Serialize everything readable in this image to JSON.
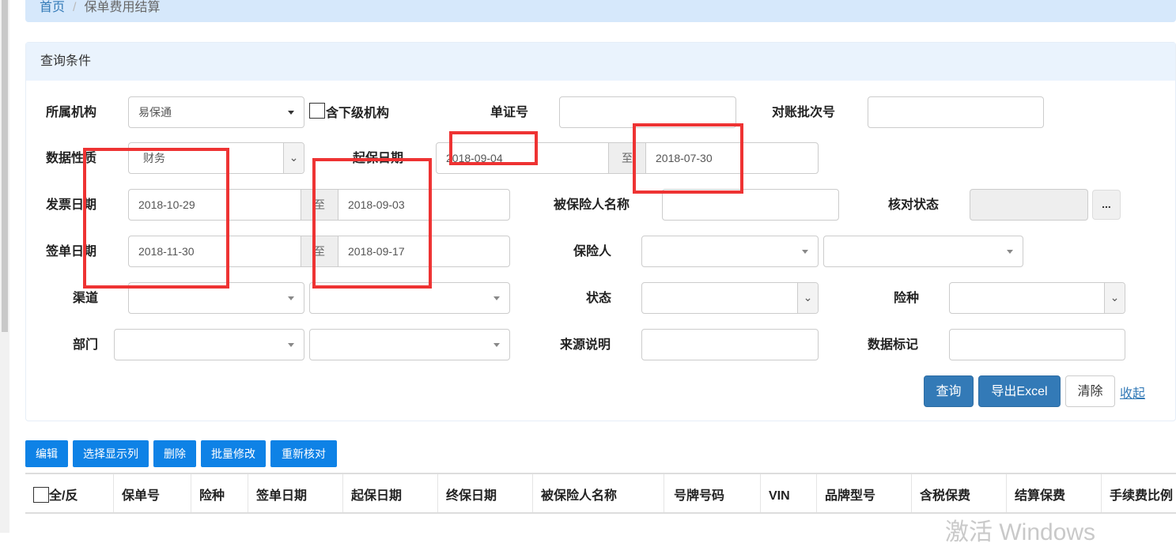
{
  "breadcrumb": {
    "home": "首页",
    "separator": "/",
    "current": "保单费用结算"
  },
  "panel": {
    "title": "查询条件"
  },
  "form": {
    "org_label": "所属机构",
    "org_value": "易保通",
    "include_sub_label": "含下级机构",
    "cert_no_label": "单证号",
    "cert_no_value": "",
    "batch_no_label": "对账批次号",
    "batch_no_value": "",
    "data_nature_label": "数据性质",
    "data_nature_value": "财务",
    "start_date_label": "起保日期",
    "start_date_from": "2018-09-04",
    "start_date_to": "2018-07-30",
    "invoice_date_label": "发票日期",
    "invoice_date_from": "2018-10-29",
    "invoice_date_to": "2018-09-03",
    "insured_name_label": "被保险人名称",
    "insured_name_value": "",
    "check_status_label": "核对状态",
    "check_status_value": "",
    "check_status_more": "...",
    "sign_date_label": "签单日期",
    "sign_date_from": "2018-11-30",
    "sign_date_to": "2018-09-17",
    "insurer_label": "保险人",
    "channel_label": "渠道",
    "status_label": "状态",
    "risk_type_label": "险种",
    "dept_label": "部门",
    "source_desc_label": "来源说明",
    "source_desc_value": "",
    "data_mark_label": "数据标记",
    "data_mark_value": "",
    "range_to": "至"
  },
  "actions": {
    "query": "查询",
    "export": "导出Excel",
    "clear": "清除",
    "collapse": "收起"
  },
  "toolbar": {
    "edit": "编辑",
    "choose_columns": "选择显示列",
    "delete": "删除",
    "batch_edit": "批量修改",
    "recheck": "重新核对"
  },
  "table": {
    "columns": [
      "全/反",
      "保单号",
      "险种",
      "签单日期",
      "起保日期",
      "终保日期",
      "被保险人名称",
      "号牌号码",
      "VIN",
      "品牌型号",
      "含税保费",
      "结算保费",
      "手续费比例"
    ]
  },
  "watermark": "激活 Windows"
}
